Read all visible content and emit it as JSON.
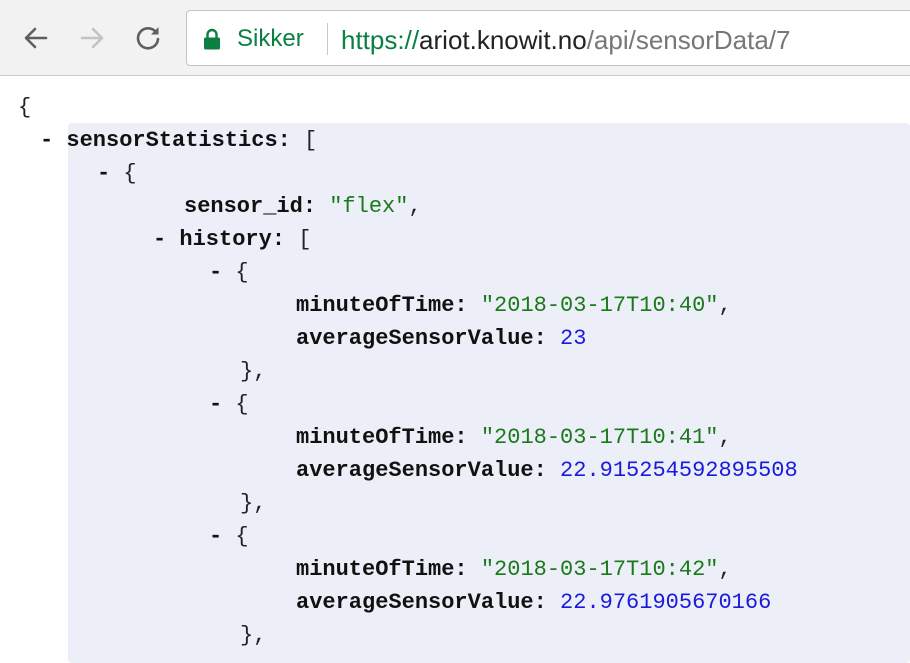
{
  "browser": {
    "secure_label": "Sikker",
    "url": {
      "scheme": "https://",
      "host": "ariot.knowit.no",
      "path": "/api/sensorData/7"
    },
    "icons": [
      "back-arrow-icon",
      "forward-arrow-icon",
      "reload-icon",
      "lock-icon"
    ]
  },
  "json": {
    "root_open": "{",
    "collapse": "-",
    "sensorStatistics_key": "sensorStatistics:",
    "array_open": "[",
    "object_open": "{",
    "sensor_id_key": "sensor_id:",
    "sensor_id_value": "\"flex\"",
    "comma": ",",
    "history_key": "history:",
    "entries": [
      {
        "minute_key": "minuteOfTime:",
        "minute_value": "\"2018-03-17T10:40\"",
        "avg_key": "averageSensorValue:",
        "avg_value": "23",
        "close": "},"
      },
      {
        "minute_key": "minuteOfTime:",
        "minute_value": "\"2018-03-17T10:41\"",
        "avg_key": "averageSensorValue:",
        "avg_value": "22.915254592895508",
        "close": "},"
      },
      {
        "minute_key": "minuteOfTime:",
        "minute_value": "\"2018-03-17T10:42\"",
        "avg_key": "averageSensorValue:",
        "avg_value": "22.9761905670166",
        "close": "},"
      }
    ]
  },
  "colors": {
    "secure": "#0b8043",
    "string": "#1a7a1a",
    "number": "#1a1adc",
    "highlight": "#eceef8"
  }
}
